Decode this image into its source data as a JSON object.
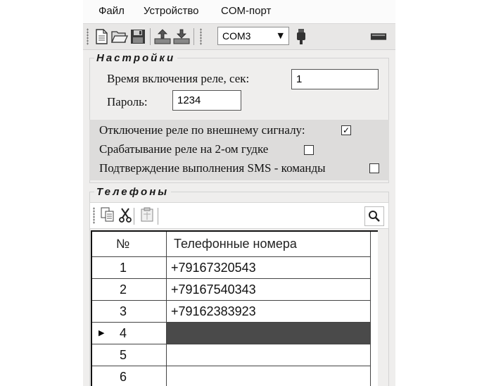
{
  "menu": {
    "file": "Файл",
    "device": "Устройство",
    "com_port": "COM-порт"
  },
  "toolbar": {
    "port_value": "COM3",
    "icons": [
      "new-document-icon",
      "open-folder-icon",
      "save-icon",
      "upload-to-device-icon",
      "download-from-device-icon",
      "usb-plug-icon",
      "connection-icon"
    ]
  },
  "settings": {
    "title": "Настройки",
    "relay_time_label": "Время включения реле, сек:",
    "relay_time_value": "1",
    "password_label": "Пароль:",
    "password_value": "1234",
    "options": [
      {
        "label": "Отключение реле по внешнему сигналу:",
        "checked": true
      },
      {
        "label": "Срабатывание реле на 2-ом гудке",
        "checked": false
      },
      {
        "label": "Подтверждение выполнения SMS - команды",
        "checked": false
      }
    ]
  },
  "phones": {
    "title": "Телефоны",
    "toolbar_icons": [
      "copy-icon",
      "cut-icon",
      "paste-icon",
      "search-icon"
    ],
    "columns": [
      "№",
      "Телефонные номера"
    ],
    "rows": [
      {
        "num": "1",
        "phone": "+79167320543"
      },
      {
        "num": "2",
        "phone": "+79167540343"
      },
      {
        "num": "3",
        "phone": "+79162383923"
      },
      {
        "num": "4",
        "phone": ""
      },
      {
        "num": "5",
        "phone": ""
      },
      {
        "num": "6",
        "phone": ""
      }
    ],
    "selected_row": 3
  },
  "colors": {
    "window_bg": "#efeeed",
    "selection": "#4a4a4a",
    "group_bg": "#dddcdb"
  }
}
